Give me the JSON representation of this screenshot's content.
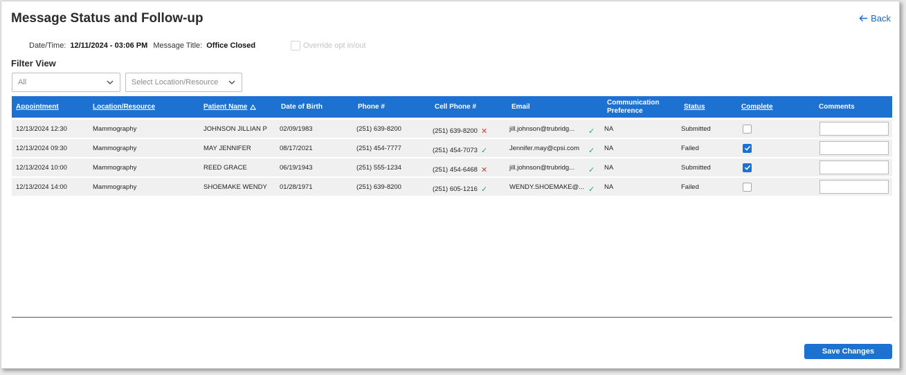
{
  "page": {
    "title": "Message Status and Follow-up",
    "back_label": "Back"
  },
  "meta": {
    "datetime_label": "Date/Time:",
    "datetime_value": "12/11/2024 - 03:06 PM",
    "message_title_label": "Message Title:",
    "message_title_value": "Office Closed",
    "override_label": "Override opt in/out"
  },
  "filter": {
    "title": "Filter View",
    "view_select": "All",
    "location_select": "Select Location/Resource"
  },
  "table": {
    "headers": {
      "appointment": "Appointment",
      "location": "Location/Resource",
      "patient": "Patient Name",
      "dob": "Date of Birth",
      "phone": "Phone #",
      "cell": "Cell Phone #",
      "email": "Email",
      "comm_line1": "Communication",
      "comm_line2": "Preference",
      "status": "Status",
      "complete": "Complete",
      "comments": "Comments"
    },
    "rows": [
      {
        "appointment": "12/13/2024 12:30",
        "location": "Mammography",
        "patient": "JOHNSON JILLIAN P",
        "dob": "02/09/1983",
        "phone": "(251) 639-8200",
        "cell": "(251) 639-8200",
        "cell_mark": "✕",
        "email": "jill.johnson@trubridg...",
        "email_mark": "✓",
        "comm": "NA",
        "status": "Submitted",
        "complete": false
      },
      {
        "appointment": "12/13/2024 09:30",
        "location": "Mammography",
        "patient": "MAY JENNIFER",
        "dob": "08/17/2021",
        "phone": "(251) 454-7777",
        "cell": "(251) 454-7073",
        "cell_mark": "✓",
        "email": "Jennifer.may@cpsi.com",
        "email_mark": "✓",
        "comm": "NA",
        "status": "Failed",
        "complete": true
      },
      {
        "appointment": "12/13/2024 10:00",
        "location": "Mammography",
        "patient": "REED GRACE",
        "dob": "06/19/1943",
        "phone": "(251) 555-1234",
        "cell": "(251) 454-6468",
        "cell_mark": "✕",
        "email": "jill.johnson@trubridg...",
        "email_mark": "✓",
        "comm": "NA",
        "status": "Submitted",
        "complete": true
      },
      {
        "appointment": "12/13/2024 14:00",
        "location": "Mammography",
        "patient": "SHOEMAKE WENDY",
        "dob": "01/28/1971",
        "phone": "(251) 639-8200",
        "cell": "(251) 605-1216",
        "cell_mark": "✓",
        "email": "WENDY.SHOEMAKE@...",
        "email_mark": "✓",
        "comm": "NA",
        "status": "Failed",
        "complete": false
      }
    ]
  },
  "footer": {
    "save_label": "Save Changes"
  },
  "colors": {
    "accent": "#1d71d0",
    "ok": "#1f9e8f",
    "bad": "#d83a3a"
  }
}
